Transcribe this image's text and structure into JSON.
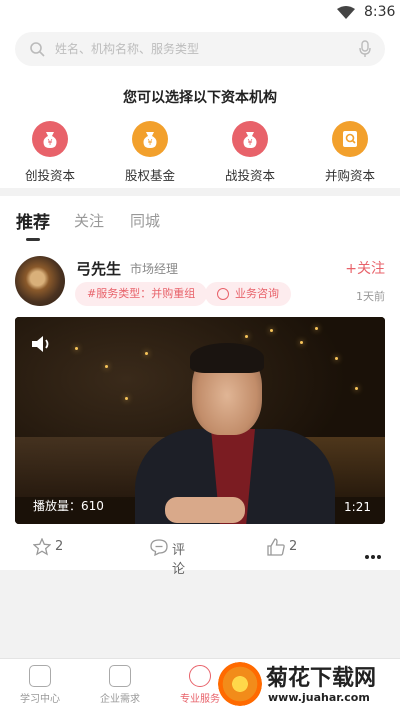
{
  "status_bar": {
    "time": "8:36",
    "wifi_icon": "wifi-icon"
  },
  "search": {
    "placeholder": "姓名、机构名称、服务类型",
    "icon": "search-icon",
    "voice_icon": "microphone-icon"
  },
  "institutions": {
    "title": "您可以选择以下资本机构",
    "items": [
      {
        "label": "创投资本",
        "icon": "money-bag-icon",
        "color": "#e8626a"
      },
      {
        "label": "股权基金",
        "icon": "money-bag-icon",
        "color": "#f2a02c"
      },
      {
        "label": "战投资本",
        "icon": "money-bag-icon",
        "color": "#e8626a"
      },
      {
        "label": "并购资本",
        "icon": "search-document-icon",
        "color": "#f2a02c"
      }
    ]
  },
  "feed_tabs": [
    {
      "label": "推荐",
      "active": true
    },
    {
      "label": "关注",
      "active": false
    },
    {
      "label": "同城",
      "active": false
    }
  ],
  "post": {
    "author": "弓先生",
    "role": "市场经理",
    "follow_label": "+关注",
    "service_tag": "#服务类型：并购重组",
    "consult_tag": "业务咨询",
    "time_ago": "1天前",
    "video": {
      "views": "播放量：610",
      "duration": "1:21"
    },
    "actions": {
      "likes": "2",
      "comment_label": "评论",
      "thumbs": "2"
    }
  },
  "bottom_nav": [
    {
      "label": "学习中心",
      "icon": "book-icon"
    },
    {
      "label": "企业需求",
      "icon": "search-icon"
    },
    {
      "label": "专业服务",
      "icon": "heart-icon",
      "active": true
    }
  ],
  "watermark": {
    "name": "菊花下载网",
    "url": "www.juahar.com"
  },
  "colors": {
    "accent": "#e8626a",
    "orange": "#f2a02c"
  }
}
